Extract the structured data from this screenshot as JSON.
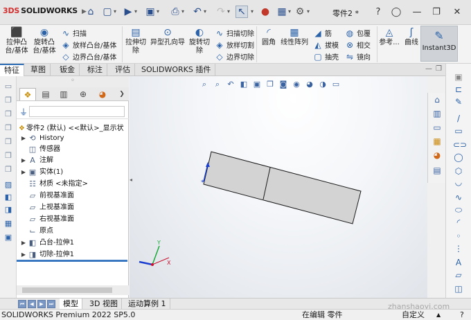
{
  "app": {
    "logo_text": "SOLIDWORKS",
    "logo_prefix": "3DS",
    "logo_caret": "▶",
    "document_title": "零件2 *"
  },
  "quick_access": {
    "icons": [
      "home-icon",
      "new-document-icon",
      "open-icon",
      "save-icon",
      "print-icon",
      "undo-icon",
      "redo-icon",
      "select-icon",
      "traffic-light-icon",
      "rebuild-icon",
      "options-gear-icon"
    ],
    "search_icon": "search-icon",
    "help_icon": "help-icon",
    "user_icon": "user-icon"
  },
  "ribbon": {
    "extruded_boss": "拉伸凸\n台/基体",
    "revolved_boss": "旋转凸\n台/基体",
    "sweep": "扫描",
    "loft": "放样凸台/基体",
    "boundary_boss": "边界凸台/基体",
    "extruded_cut": "拉伸切\n除",
    "hole_wizard": "异型孔向导",
    "revolved_cut": "旋转切\n除",
    "swept_cut": "扫描切除",
    "lofted_cut": "放样切割",
    "boundary_cut": "边界切除",
    "fillet": "圆角",
    "linear_pattern": "线性阵列",
    "rib": "筋",
    "draft": "拔模",
    "shell": "抽壳",
    "wrap": "包覆",
    "intersect": "相交",
    "mirror": "镜向",
    "reference": "参考...",
    "curves": "曲线",
    "instant3d": "Instant3D"
  },
  "command_tabs": [
    {
      "label": "特征",
      "active": true
    },
    {
      "label": "草图",
      "active": false
    },
    {
      "label": "钣金",
      "active": false
    },
    {
      "label": "标注",
      "active": false
    },
    {
      "label": "评估",
      "active": false
    },
    {
      "label": "SOLIDWORKS 插件",
      "active": false
    }
  ],
  "feature_tree": {
    "root": "零件2 (默认) <<默认>_显示状",
    "items": [
      {
        "label": "History",
        "icon": "history-icon",
        "expandable": true
      },
      {
        "label": "传感器",
        "icon": "sensor-icon",
        "expandable": false
      },
      {
        "label": "注解",
        "icon": "annotations-icon",
        "expandable": true
      },
      {
        "label": "实体(1)",
        "icon": "solid-bodies-icon",
        "expandable": true
      },
      {
        "label": "材质 <未指定>",
        "icon": "material-icon",
        "expandable": false
      },
      {
        "label": "前视基准面",
        "icon": "plane-icon",
        "expandable": false
      },
      {
        "label": "上视基准面",
        "icon": "plane-icon",
        "expandable": false
      },
      {
        "label": "右视基准面",
        "icon": "plane-icon",
        "expandable": false
      },
      {
        "label": "原点",
        "icon": "origin-icon",
        "expandable": false
      },
      {
        "label": "凸台-拉伸1",
        "icon": "boss-extrude-icon",
        "expandable": true
      },
      {
        "label": "切除-拉伸1",
        "icon": "cut-extrude-icon",
        "expandable": true
      }
    ]
  },
  "bottom_tabs": [
    {
      "label": "模型",
      "active": true
    },
    {
      "label": "3D 视图",
      "active": false
    },
    {
      "label": "运动算例 1",
      "active": false
    }
  ],
  "status": {
    "version": "SOLIDWORKS Premium 2022 SP5.0",
    "mode": "在编辑 零件",
    "units": "自定义",
    "units_caret": "▲",
    "help": "?"
  },
  "watermark": "zhanshaoyi.com",
  "triad": {
    "y_label": "Y",
    "x_label": "X"
  },
  "colors": {
    "accent": "#2f6db5",
    "part_fill": "#d3d3d3",
    "part_stroke": "#1a1a1a"
  }
}
